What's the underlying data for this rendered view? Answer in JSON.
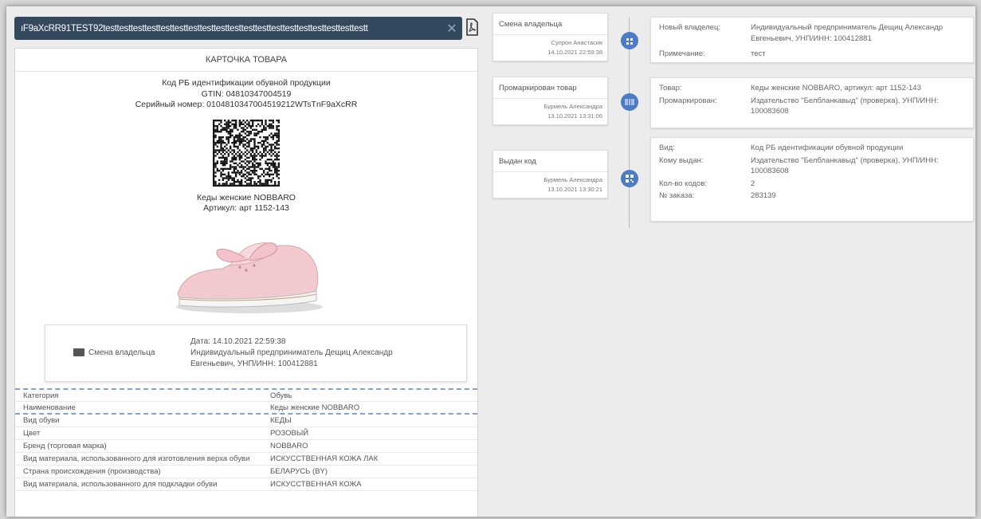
{
  "search": {
    "value": "ıF9aXcRR​​91TEST​​92testtesttesttesttesttesttesttesttesttesttesttesttesttesttesttesttesttesttestt"
  },
  "card": {
    "title": "КАРТОЧКА ТОВАРА",
    "code_type": "Код РБ идентификации обувной продукции",
    "gtin": "GTIN: 04810347004519",
    "serial": "Серийный номер: 0104810347004519212WTsTnF9aXcRR",
    "product_name": "Кеды женские NOBBARO",
    "article": "Артикул: арт 1152-143",
    "owner_change": {
      "label": "Смена владельца",
      "date": "Дата: 14.10.2021 22:59:38",
      "owner": "Индивидуальный предприниматель Дещиц Александр Евгеньевич, УНП/ИНН: 100412881"
    },
    "properties": [
      {
        "label": "Категория",
        "value": "Обувь"
      },
      {
        "label": "Наименование",
        "value": "Кеды женские NOBBARO"
      },
      {
        "label": "Вид обуви",
        "value": "КЕДЫ"
      },
      {
        "label": "Цвет",
        "value": "РОЗОВЫЙ"
      },
      {
        "label": "Бренд (торговая марка)",
        "value": "NOBBARO"
      },
      {
        "label": "Вид материала, использованного для изготовления верха обуви",
        "value": "ИСКУССТВЕННАЯ КОЖА ЛАК"
      },
      {
        "label": "Страна происхождения (производства)",
        "value": "БЕЛАРУСЬ (BY)"
      },
      {
        "label": "Вид материала, использованного для подкладки обуви",
        "value": "ИСКУССТВЕННАЯ КОЖА"
      }
    ]
  },
  "timeline": [
    {
      "title": "Смена владельца",
      "user": "Супрон Анастасия",
      "time": "14.10.2021 22:59:38",
      "details": [
        {
          "key": "Новый владелец:",
          "value": "Индивидуальный предприниматель Дещиц Александр Евгеньевич, УНП/ИНН: 100412881"
        },
        {
          "key": "Примечание:",
          "value": "тест"
        }
      ]
    },
    {
      "title": "Промаркирован товар",
      "user": "Бурмель Александра",
      "time": "13.10.2021 13:31:06",
      "details": [
        {
          "key": "Товар:",
          "value": "Кеды женские NOBBARO, артикул: арт 1152-143"
        },
        {
          "key": "Промаркирован:",
          "value": "Издательство \"Белбланкавыд\" (проверка), УНП/ИНН: 100083608"
        }
      ]
    },
    {
      "title": "Выдан код",
      "user": "Бурмель Александра",
      "time": "13.10.2021 13:30:21",
      "details": [
        {
          "key": "Вид:",
          "value": "Код РБ идентификации обувной продукции"
        },
        {
          "key": "Кому выдан:",
          "value": "Издательство \"Белбланкавыд\" (проверка), УНП/ИНН: 100083608"
        },
        {
          "key": "Кол-во кодов:",
          "value": "2"
        },
        {
          "key": "№ заказа:",
          "value": "283139"
        }
      ]
    }
  ],
  "colors": {
    "search_bg": "#35495e",
    "accent": "#4d7cc7"
  }
}
